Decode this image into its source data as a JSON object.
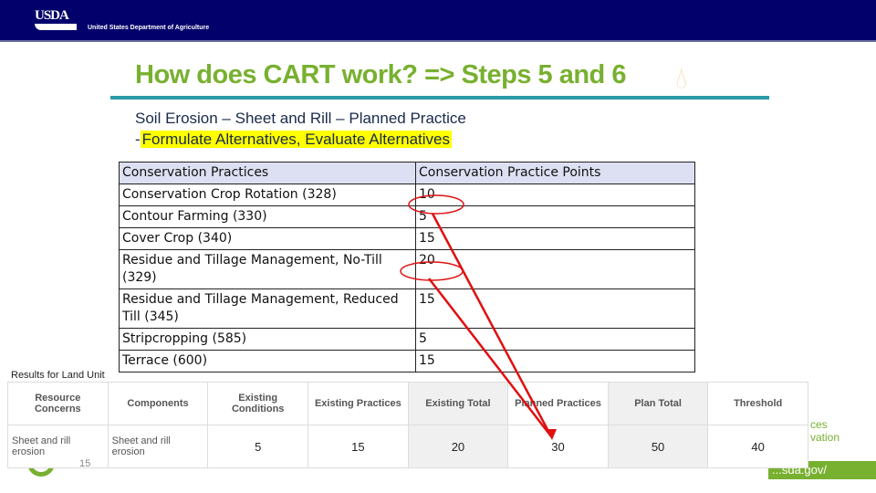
{
  "header": {
    "logo": "USDA",
    "department": "United States Department of Agriculture"
  },
  "title": "How does CART work? => Steps 5 and 6",
  "subtitle1": "Soil Erosion – Sheet and Rill – Planned Practice",
  "subtitle2_prefix": "-",
  "subtitle2": "Formulate Alternatives, Evaluate Alternatives",
  "practices": {
    "headers": [
      "Conservation Practices",
      "Conservation Practice Points"
    ],
    "rows": [
      [
        "Conservation Crop Rotation (328)",
        "10"
      ],
      [
        "Contour Farming (330)",
        "5"
      ],
      [
        "Cover Crop (340)",
        "15"
      ],
      [
        "Residue and Tillage Management, No-Till (329)",
        "20"
      ],
      [
        "Residue and Tillage Management, Reduced Till (345)",
        "15"
      ],
      [
        "Stripcropping (585)",
        "5"
      ],
      [
        "Terrace (600)",
        "15"
      ]
    ]
  },
  "results": {
    "label": "Results for Land Unit",
    "headers": [
      "Resource Concerns",
      "Components",
      "Existing Conditions",
      "Existing Practices",
      "Existing Total",
      "Planned Practices",
      "Plan Total",
      "Threshold"
    ],
    "row": [
      "Sheet and rill erosion",
      "Sheet and rill erosion",
      "5",
      "15",
      "20",
      "30",
      "50",
      "40"
    ]
  },
  "page_number": "15",
  "footer": {
    "side_text": [
      "ces",
      "vation"
    ],
    "url": "...sda.gov/"
  },
  "colors": {
    "banner": "#02006b",
    "title": "#78b030",
    "rule": "#2a9aa8",
    "highlight": "#ffff00",
    "annotation": "#e01010"
  }
}
